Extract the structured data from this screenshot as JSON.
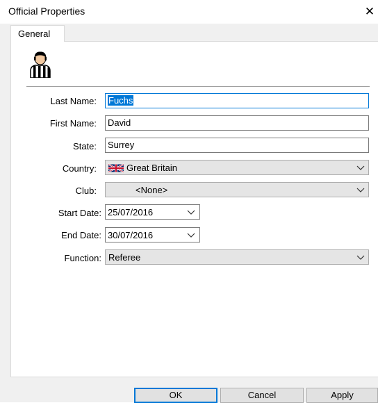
{
  "window": {
    "title": "Official Properties",
    "close_glyph": "✕"
  },
  "tabs": [
    {
      "label": "General",
      "selected": true
    }
  ],
  "form": {
    "last_name": {
      "label": "Last Name:",
      "value": "Fuchs"
    },
    "first_name": {
      "label": "First Name:",
      "value": "David"
    },
    "state": {
      "label": "State:",
      "value": "Surrey"
    },
    "country": {
      "label": "Country:",
      "value": "Great Britain",
      "flag_icon": "union-jack-flag"
    },
    "club": {
      "label": "Club:",
      "value": "<None>"
    },
    "start_date": {
      "label": "Start Date:",
      "value": "25/07/2016"
    },
    "end_date": {
      "label": "End Date:",
      "value": "30/07/2016"
    },
    "function": {
      "label": "Function:",
      "value": "Referee"
    }
  },
  "buttons": {
    "ok": "OK",
    "cancel": "Cancel",
    "apply": "Apply"
  },
  "icons": {
    "header": "referee-icon",
    "dropdown": "chevron-down-icon"
  },
  "colors": {
    "selection": "#0078d7",
    "focus_border": "#0078d7",
    "dialog_bg": "#f0f0f0",
    "combo_bg": "#e5e5e5"
  }
}
